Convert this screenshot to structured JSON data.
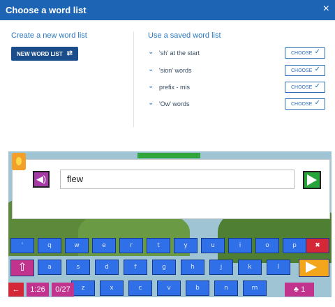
{
  "dialog": {
    "title": "Choose a word list",
    "close_icon": "×"
  },
  "create": {
    "heading": "Create a new word list",
    "button_label": "NEW WORD LIST"
  },
  "saved": {
    "heading": "Use a saved word list",
    "choose_label": "CHOOSE",
    "items": [
      {
        "name": "'sh' at the start"
      },
      {
        "name": "'sion' words"
      },
      {
        "name": "prefix - mis"
      },
      {
        "name": "'Ow' words"
      }
    ]
  },
  "game": {
    "current_word": "flew",
    "keyboard": {
      "row1": [
        "'",
        "q",
        "w",
        "e",
        "r",
        "t",
        "y",
        "u",
        "i",
        "o",
        "p"
      ],
      "row2": [
        "a",
        "s",
        "d",
        "f",
        "g",
        "h",
        "j",
        "k",
        "l"
      ],
      "row3": [
        "z",
        "x",
        "c",
        "v",
        "b",
        "n",
        "m"
      ]
    },
    "timer": "1:26",
    "progress": "0/27",
    "score": "1"
  },
  "colors": {
    "header": "#1e64b4",
    "accent": "#2a6fb5",
    "key": "#2f6fe8",
    "shift": "#c2338e",
    "backspace": "#d42838",
    "enter": "#f3a51b",
    "send": "#27a43a"
  }
}
